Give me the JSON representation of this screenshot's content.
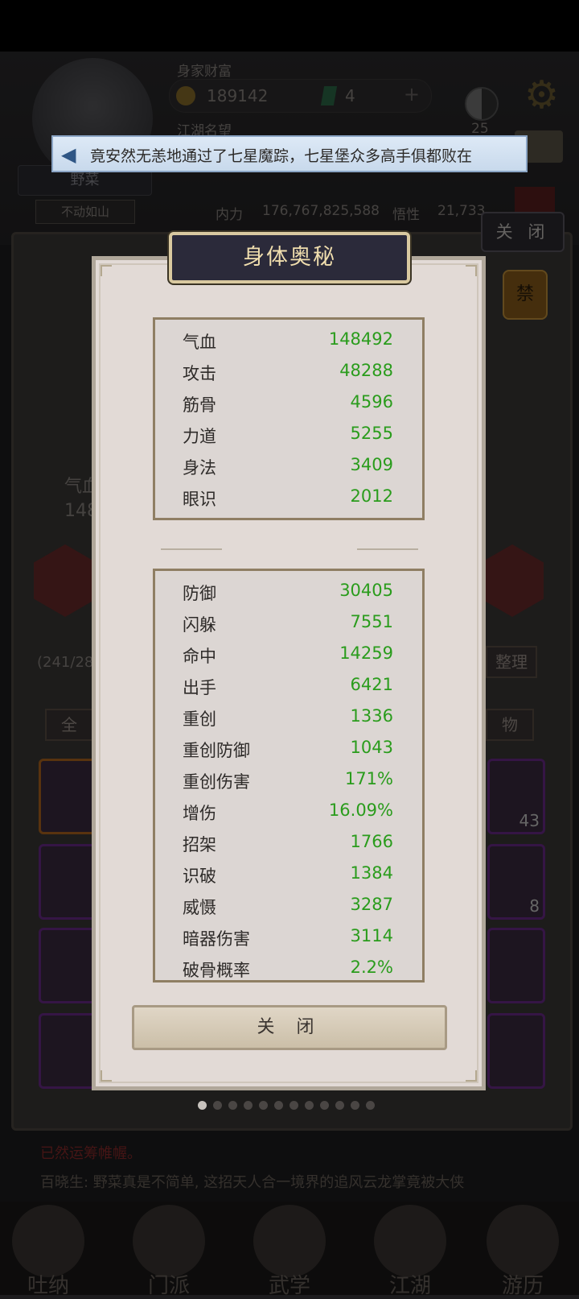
{
  "header": {
    "wealth_label": "身家财富",
    "coin_amount": "189142",
    "gem_amount": "4",
    "plus_icon": "plus-icon",
    "level_value": "25",
    "second_label": "江湖名望",
    "name": "野菜",
    "status": "不动如山",
    "neili_label": "内力",
    "neili_value": "176,767,825,588",
    "potential_label": "悟性",
    "potential_value": "21,733"
  },
  "notice": {
    "icon": "megaphone-icon",
    "text": "竟安然无恙地通过了七星魔踪，七星堡众多高手俱都败在"
  },
  "background": {
    "close_label": "关 闭",
    "ban_label": "禁",
    "qi_label": "气血",
    "qi_value": "148",
    "capacity": "(241/28",
    "sort_label": "整理",
    "all_label": "全",
    "item_label": "物",
    "item_count_1": "43",
    "item_count_2": "8",
    "log_line_1": "已然运筹帷幄。",
    "log_line_2": "百晓生: 野菜真是不简单, 这招天人合一境界的追风云龙掌竟被大侠"
  },
  "nav": [
    {
      "label": "吐纳"
    },
    {
      "label": "门派"
    },
    {
      "label": "武学"
    },
    {
      "label": "江湖"
    },
    {
      "label": "游历"
    }
  ],
  "dialog": {
    "title": "身体奥秘",
    "close_label": "关 闭",
    "base_stats": [
      {
        "label": "气血",
        "value": "148492"
      },
      {
        "label": "攻击",
        "value": "48288"
      },
      {
        "label": "筋骨",
        "value": "4596"
      },
      {
        "label": "力道",
        "value": "5255"
      },
      {
        "label": "身法",
        "value": "3409"
      },
      {
        "label": "眼识",
        "value": "2012"
      }
    ],
    "combat_stats": [
      {
        "label": "防御",
        "value": "30405"
      },
      {
        "label": "闪躲",
        "value": "7551"
      },
      {
        "label": "命中",
        "value": "14259"
      },
      {
        "label": "出手",
        "value": "6421"
      },
      {
        "label": "重创",
        "value": "1336"
      },
      {
        "label": "重创防御",
        "value": "1043"
      },
      {
        "label": "重创伤害",
        "value": "171%"
      },
      {
        "label": "增伤",
        "value": "16.09%"
      },
      {
        "label": "招架",
        "value": "1766"
      },
      {
        "label": "识破",
        "value": "1384"
      },
      {
        "label": "威慑",
        "value": "3287"
      },
      {
        "label": "暗器伤害",
        "value": "3114"
      },
      {
        "label": "破骨概率",
        "value": "2.2%"
      }
    ],
    "page_count": 12,
    "active_page": 0
  }
}
